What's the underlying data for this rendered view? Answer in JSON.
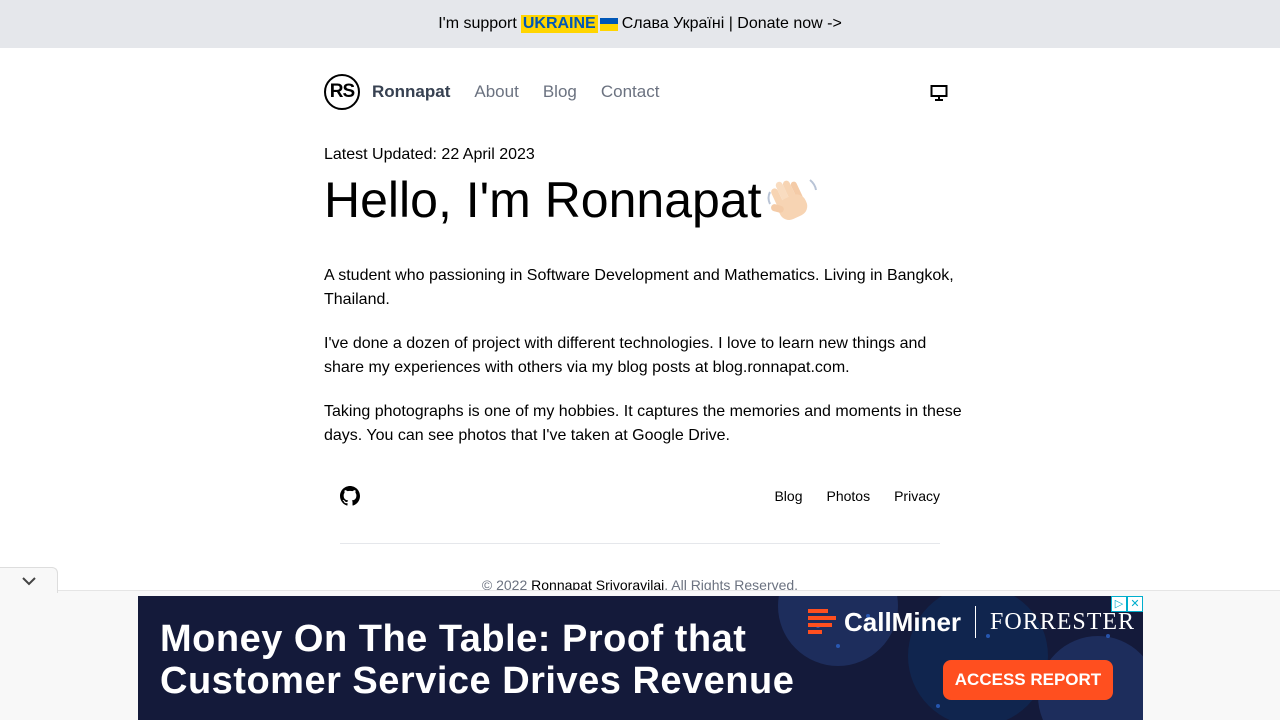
{
  "banner": {
    "prefix": "I'm support",
    "highlight": "UKRAINE",
    "suffix": "Слава Україні | Donate now ->"
  },
  "nav": {
    "logo_text": "RS",
    "brand": "Ronnapat",
    "links": [
      "About",
      "Blog",
      "Contact"
    ],
    "theme_icon": "monitor-icon"
  },
  "main": {
    "updated": "Latest Updated: 22 April 2023",
    "heading": "Hello, I'm Ronnapat",
    "paragraphs": [
      "A student who passioning in Software Development and Mathematics. Living in Bangkok, Thailand.",
      "I've done a dozen of project with different technologies. I love to learn new things and share my experiences with others via my blog posts at blog.ronnapat.com.",
      "Taking photographs is one of my hobbies. It captures the memories and moments in these days. You can see photos that I've taken at Google Drive."
    ]
  },
  "footer": {
    "social_icon": "github-icon",
    "links": [
      "Blog",
      "Photos",
      "Privacy"
    ],
    "copyright_prefix": "© 2022",
    "copyright_owner": "Ronnapat Srivoravilai",
    "copyright_suffix": ". All Rights Reserved."
  },
  "ad": {
    "headline_line1": "Money On The Table: Proof that",
    "headline_line2": "Customer Service Drives Revenue",
    "brand": "CallMiner",
    "partner": "FORRESTER",
    "cta": "ACCESS REPORT",
    "colors": {
      "background": "#141a3a",
      "cta": "#ff4f1f"
    }
  },
  "colors": {
    "banner_bg": "#e5e7eb",
    "ukraine_blue": "#0057b7",
    "ukraine_yellow": "#ffd500",
    "nav_muted": "#6b7280",
    "brand_text": "#374151"
  }
}
